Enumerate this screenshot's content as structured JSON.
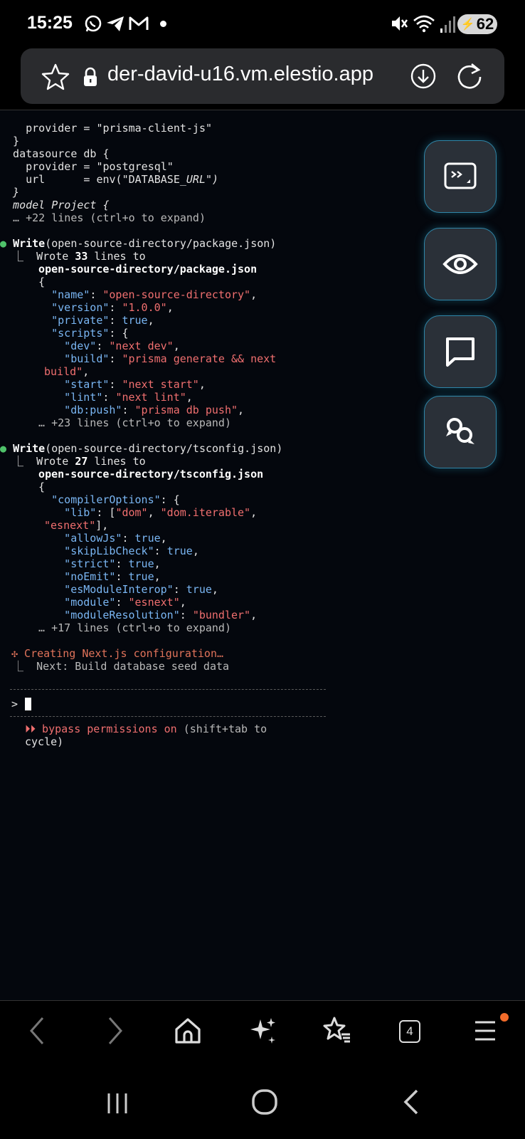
{
  "status_bar": {
    "time": "15:25",
    "battery": "62",
    "notification_icons": [
      "whatsapp-icon",
      "telegram-icon",
      "gmail-icon",
      "dot-icon"
    ],
    "system_icons": [
      "mute-icon",
      "wifi-icon",
      "signal-icon",
      "battery-icon"
    ]
  },
  "browser": {
    "url": "der-david-u16.vm.elestio.app"
  },
  "terminal": {
    "block1": {
      "line1": "    provider = \"prisma-client-js\"",
      "line2": "  }",
      "line3": "  datasource db {",
      "line4": "    provider = \"postgresql\"",
      "line5a": "    url      = env(\"DATABASE_",
      "line5b": "URL\")",
      "line6": "  }",
      "line7": "  model Project {",
      "line8": "  … +22 lines (ctrl+o to expand)"
    },
    "write1": {
      "bullet": "●",
      "tool": "Write",
      "path": "(open-source-directory/package.json)",
      "result_prefix": "  ⎿  Wrote ",
      "result_count": "33",
      "result_suffix": " lines to",
      "file": "  open-source-directory/package.json",
      "l1": "  {",
      "l2k": "    \"name\"",
      "l2v": "\"open-source-directory\"",
      "l3k": "    \"version\"",
      "l3v": "\"1.0.0\"",
      "l4k": "    \"private\"",
      "l4v": "true",
      "l5k": "    \"scripts\"",
      "l5p": ": {",
      "l6k": "      \"dev\"",
      "l6v": "\"next dev\"",
      "l7k": "      \"build\"",
      "l7v": "\"prisma generate && next",
      "l8v": "build\"",
      "l9k": "      \"start\"",
      "l9v": "\"next start\"",
      "l10k": "      \"lint\"",
      "l10v": "\"next lint\"",
      "l11k": "      \"db:push\"",
      "l11v": "\"prisma db push\"",
      "more": "  … +23 lines (ctrl+o to expand)"
    },
    "write2": {
      "bullet": "●",
      "tool": "Write",
      "path": "(open-source-directory/tsconfig.json)",
      "result_prefix": "  ⎿  Wrote ",
      "result_count": "27",
      "result_suffix": " lines to",
      "file": "  open-source-directory/tsconfig.json",
      "l1": "  {",
      "l2k": "    \"compilerOptions\"",
      "l2p": ": {",
      "l3k": "      \"lib\"",
      "l3v1": "\"dom\"",
      "l3v2": "\"dom.iterable\"",
      "l4v": "\"esnext\"",
      "l5k": "      \"allowJs\"",
      "l5v": "true",
      "l6k": "      \"skipLibCheck\"",
      "l6v": "true",
      "l7k": "      \"strict\"",
      "l7v": "true",
      "l8k": "      \"noEmit\"",
      "l8v": "true",
      "l9k": "      \"esModuleInterop\"",
      "l9v": "true",
      "l10k": "      \"module\"",
      "l10v": "\"esnext\"",
      "l11k": "      \"moduleResolution\"",
      "l11v": "\"bundler\"",
      "more": "  … +17 lines (ctrl+o to expand)"
    },
    "status": {
      "spinner": "✣",
      "text": " Creating Next.js configuration…",
      "next": "  ⎿  Next: Build database seed data"
    },
    "prompt": ">",
    "footer": {
      "icon": "⏵⏵",
      "text": " bypass permissions on ",
      "hint": "(shift+tab to",
      "hint2": "cycle)"
    }
  },
  "floating_buttons": [
    "terminal-icon",
    "eye-icon",
    "chat-icon",
    "people-chat-icon"
  ],
  "toolbar": {
    "tab_count": "4"
  }
}
